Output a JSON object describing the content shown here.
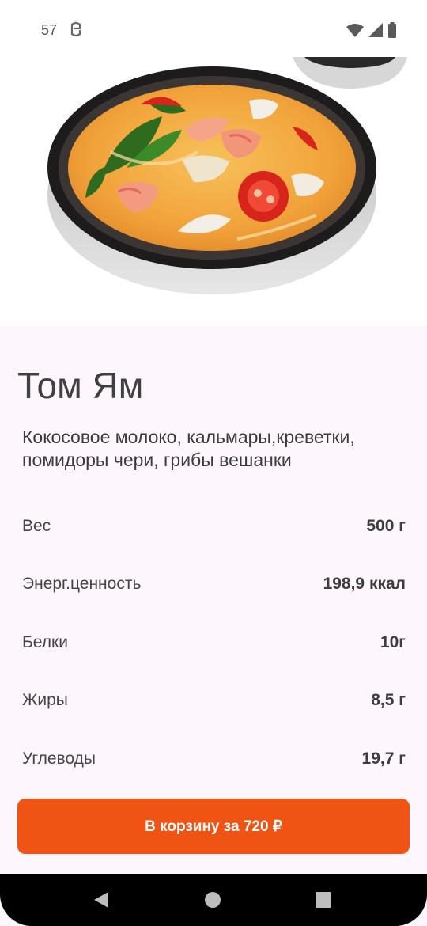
{
  "status_bar": {
    "time": "57",
    "icons": [
      "notification-icon",
      "wifi-icon",
      "signal-icon",
      "battery-icon"
    ]
  },
  "product": {
    "image": "tom-yum-soup-bowl",
    "name": "Том Ям",
    "description": "Кокосовое молоко, кальмары,креветки, помидоры чери, грибы вешанки"
  },
  "nutrition": [
    {
      "label": "Вес",
      "value": "500 г"
    },
    {
      "label": "Энерг.ценность",
      "value": "198,9 ккал"
    },
    {
      "label": "Белки",
      "value": "10г"
    },
    {
      "label": "Жиры",
      "value": "8,5 г"
    },
    {
      "label": "Углеводы",
      "value": "19,7 г"
    }
  ],
  "cart_button": {
    "label": "В корзину за 720 ₽",
    "color": "#f05414"
  },
  "nav_bar": {
    "icons": [
      "back-icon",
      "home-icon",
      "recents-icon"
    ]
  }
}
